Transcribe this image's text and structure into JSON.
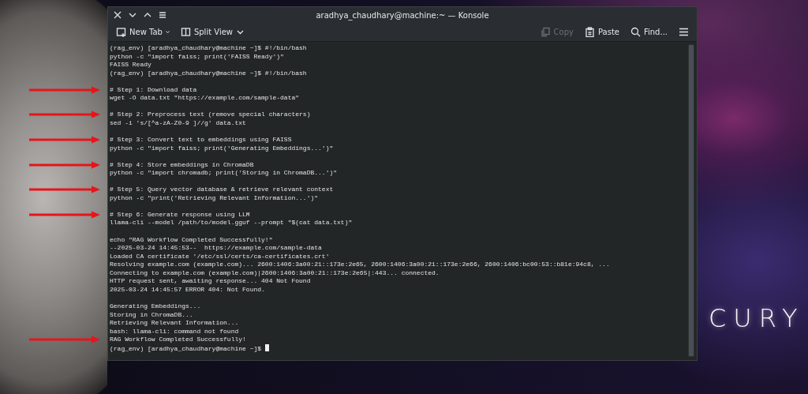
{
  "window": {
    "title": "aradhya_chaudhary@machine:~ — Konsole"
  },
  "toolbar": {
    "left": [
      {
        "label": "New Tab",
        "disabled": false
      },
      {
        "label": "Split View",
        "disabled": false
      }
    ],
    "right": [
      {
        "label": "Copy",
        "disabled": true
      },
      {
        "label": "Paste",
        "disabled": false
      },
      {
        "label": "Find...",
        "disabled": false
      }
    ]
  },
  "terminal": {
    "cursor_on_last_line": true,
    "lines": [
      {
        "kind": "text",
        "text": "(rag_env) [aradhya_chaudhary@machine ~]$ #!/bin/bash",
        "arrow": false
      },
      {
        "kind": "text",
        "text": "python -c \"import faiss; print('FAISS Ready')\"",
        "arrow": false
      },
      {
        "kind": "text",
        "text": "FAISS Ready",
        "arrow": false
      },
      {
        "kind": "text",
        "text": "(rag_env) [aradhya_chaudhary@machine ~]$ #!/bin/bash",
        "arrow": false
      },
      {
        "kind": "blank"
      },
      {
        "kind": "text",
        "text": "# Step 1: Download data",
        "arrow": true
      },
      {
        "kind": "text",
        "text": "wget -O data.txt \"https://example.com/sample-data\"",
        "arrow": false
      },
      {
        "kind": "blank"
      },
      {
        "kind": "text",
        "text": "# Step 2: Preprocess text (remove special characters)",
        "arrow": true
      },
      {
        "kind": "text",
        "text": "sed -i 's/[^a-zA-Z0-9 ]//g' data.txt",
        "arrow": false
      },
      {
        "kind": "blank"
      },
      {
        "kind": "text",
        "text": "# Step 3: Convert text to embeddings using FAISS",
        "arrow": true
      },
      {
        "kind": "text",
        "text": "python -c \"import faiss; print('Generating Embeddings...')\"",
        "arrow": false
      },
      {
        "kind": "blank"
      },
      {
        "kind": "text",
        "text": "# Step 4: Store embeddings in ChromaDB",
        "arrow": true
      },
      {
        "kind": "text",
        "text": "python -c \"import chromadb; print('Storing in ChromaDB...')\"",
        "arrow": false
      },
      {
        "kind": "blank"
      },
      {
        "kind": "text",
        "text": "# Step 5: Query vector database & retrieve relevant context",
        "arrow": true
      },
      {
        "kind": "text",
        "text": "python -c \"print('Retrieving Relevant Information...')\"",
        "arrow": false
      },
      {
        "kind": "blank"
      },
      {
        "kind": "text",
        "text": "# Step 6: Generate response using LLM",
        "arrow": true
      },
      {
        "kind": "text",
        "text": "llama-cli --model /path/to/model.gguf --prompt \"$(cat data.txt)\"",
        "arrow": false
      },
      {
        "kind": "blank"
      },
      {
        "kind": "text",
        "text": "echo \"RAG Workflow Completed Successfully!\"",
        "arrow": false
      },
      {
        "kind": "text",
        "text": "--2025-03-24 14:45:53--  https://example.com/sample-data",
        "arrow": false
      },
      {
        "kind": "text",
        "text": "Loaded CA certificate '/etc/ssl/certs/ca-certificates.crt'",
        "arrow": false
      },
      {
        "kind": "text",
        "text": "Resolving example.com (example.com)... 2600:1406:3a00:21::173e:2e65, 2600:1406:3a00:21::173e:2e66, 2600:1406:bc00:53::b81e:94c8, ...",
        "arrow": false
      },
      {
        "kind": "text",
        "text": "Connecting to example.com (example.com)|2600:1406:3a00:21::173e:2e65|:443... connected.",
        "arrow": false
      },
      {
        "kind": "text",
        "text": "HTTP request sent, awaiting response... 404 Not Found",
        "arrow": false
      },
      {
        "kind": "text",
        "text": "2025-03-24 14:45:57 ERROR 404: Not Found.",
        "arrow": false
      },
      {
        "kind": "blank"
      },
      {
        "kind": "text",
        "text": "Generating Embeddings...",
        "arrow": false
      },
      {
        "kind": "text",
        "text": "Storing in ChromaDB...",
        "arrow": false
      },
      {
        "kind": "text",
        "text": "Retrieving Relevant Information...",
        "arrow": false
      },
      {
        "kind": "text",
        "text": "bash: llama-cli: command not found",
        "arrow": false
      },
      {
        "kind": "text",
        "text": "RAG Workflow Completed Successfully!",
        "arrow": true
      },
      {
        "kind": "text",
        "text": "(rag_env) [aradhya_chaudhary@machine ~]$ ",
        "arrow": false
      }
    ]
  },
  "wallpaper": {
    "text": "CURY"
  }
}
